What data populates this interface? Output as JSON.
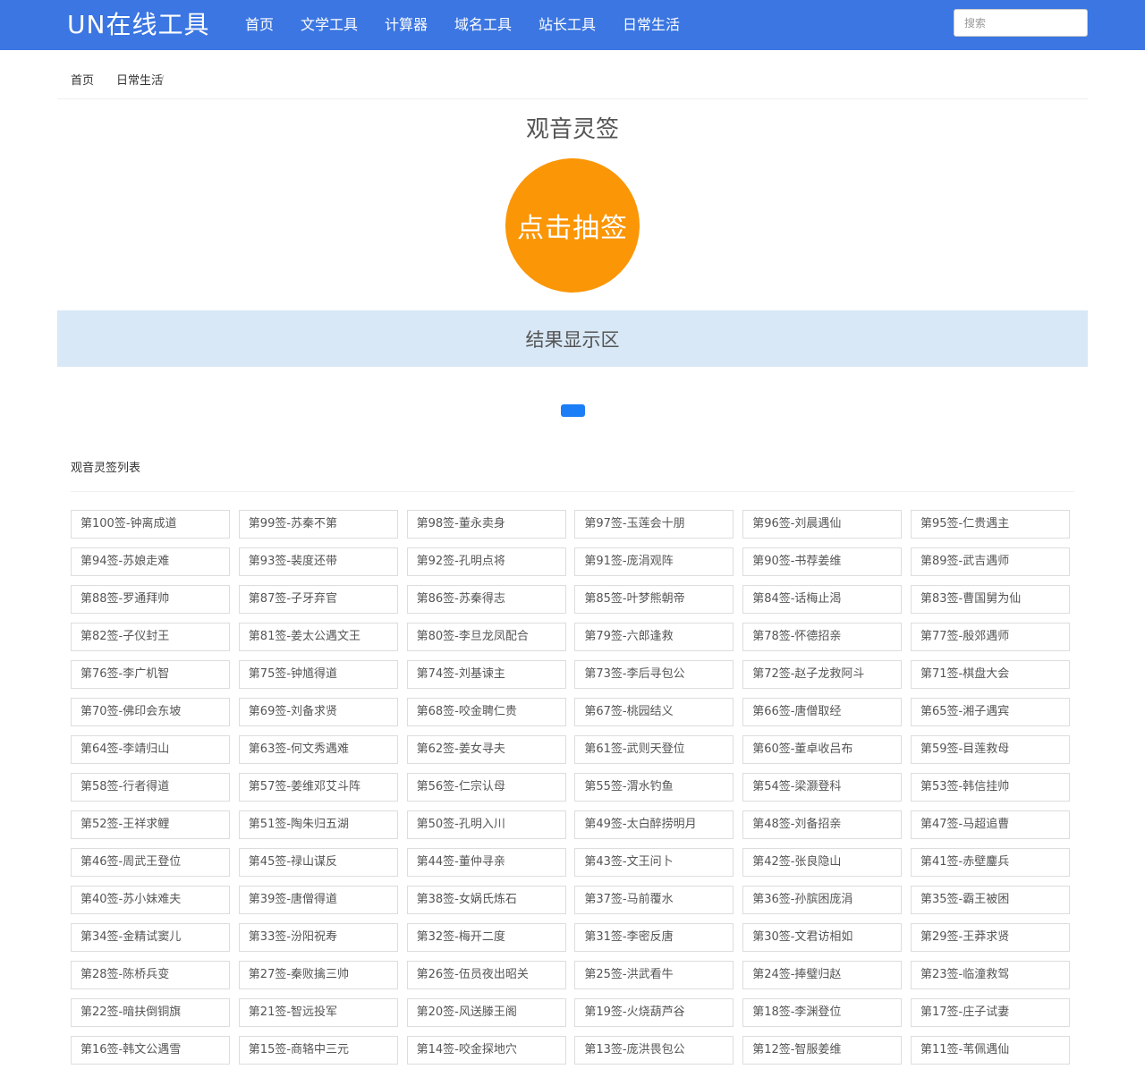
{
  "header": {
    "brand": "UN在线工具",
    "nav": [
      "首页",
      "文学工具",
      "计算器",
      "域名工具",
      "站长工具",
      "日常生活"
    ],
    "search_placeholder": "搜索"
  },
  "breadcrumb": {
    "home": "首页",
    "separator": "/",
    "current": "日常生活"
  },
  "main": {
    "title": "观音灵签",
    "draw_button": "点击抽签",
    "result_text": "结果显示区"
  },
  "list": {
    "title": "观音灵签列表",
    "items": [
      "第100签-钟离成道",
      "第99签-苏秦不第",
      "第98签-董永卖身",
      "第97签-玉莲会十朋",
      "第96签-刘晨遇仙",
      "第95签-仁贵遇主",
      "第94签-苏娘走难",
      "第93签-裴度还带",
      "第92签-孔明点将",
      "第91签-庞涓观阵",
      "第90签-书荐姜维",
      "第89签-武吉遇师",
      "第88签-罗通拜帅",
      "第87签-子牙弃官",
      "第86签-苏秦得志",
      "第85签-叶梦熊朝帝",
      "第84签-话梅止渴",
      "第83签-曹国舅为仙",
      "第82签-子仪封王",
      "第81签-姜太公遇文王",
      "第80签-李旦龙凤配合",
      "第79签-六郎逢救",
      "第78签-怀德招亲",
      "第77签-殷郊遇师",
      "第76签-李广机智",
      "第75签-钟馗得道",
      "第74签-刘基谏主",
      "第73签-李后寻包公",
      "第72签-赵子龙救阿斗",
      "第71签-棋盘大会",
      "第70签-佛印会东坡",
      "第69签-刘备求贤",
      "第68签-咬金聘仁贵",
      "第67签-桃园结义",
      "第66签-唐僧取经",
      "第65签-湘子遇宾",
      "第64签-李靖归山",
      "第63签-何文秀遇难",
      "第62签-姜女寻夫",
      "第61签-武则天登位",
      "第60签-董卓收吕布",
      "第59签-目莲救母",
      "第58签-行者得道",
      "第57签-姜维邓艾斗阵",
      "第56签-仁宗认母",
      "第55签-渭水钓鱼",
      "第54签-梁灏登科",
      "第53签-韩信挂帅",
      "第52签-王祥求鲤",
      "第51签-陶朱归五湖",
      "第50签-孔明入川",
      "第49签-太白醉捞明月",
      "第48签-刘备招亲",
      "第47签-马超追曹",
      "第46签-周武王登位",
      "第45签-禄山谋反",
      "第44签-董仲寻亲",
      "第43签-文王问卜",
      "第42签-张良隐山",
      "第41签-赤壁鏖兵",
      "第40签-苏小妹难夫",
      "第39签-唐僧得道",
      "第38签-女娲氏炼石",
      "第37签-马前覆水",
      "第36签-孙膑困庞涓",
      "第35签-霸王被困",
      "第34签-金精试窦儿",
      "第33签-汾阳祝寿",
      "第32签-梅开二度",
      "第31签-李密反唐",
      "第30签-文君访相如",
      "第29签-王莽求贤",
      "第28签-陈桥兵变",
      "第27签-秦败擒三帅",
      "第26签-伍员夜出昭关",
      "第25签-洪武看牛",
      "第24签-捧璧归赵",
      "第23签-临潼救驾",
      "第22签-暗扶倒铜旗",
      "第21签-智远投军",
      "第20签-风送滕王阁",
      "第19签-火烧葫芦谷",
      "第18签-李渊登位",
      "第17签-庄子试妻",
      "第16签-韩文公遇雪",
      "第15签-商辂中三元",
      "第14签-咬金探地穴",
      "第13签-庞洪畏包公",
      "第12签-智服姜维",
      "第11签-苇佩遇仙"
    ]
  }
}
